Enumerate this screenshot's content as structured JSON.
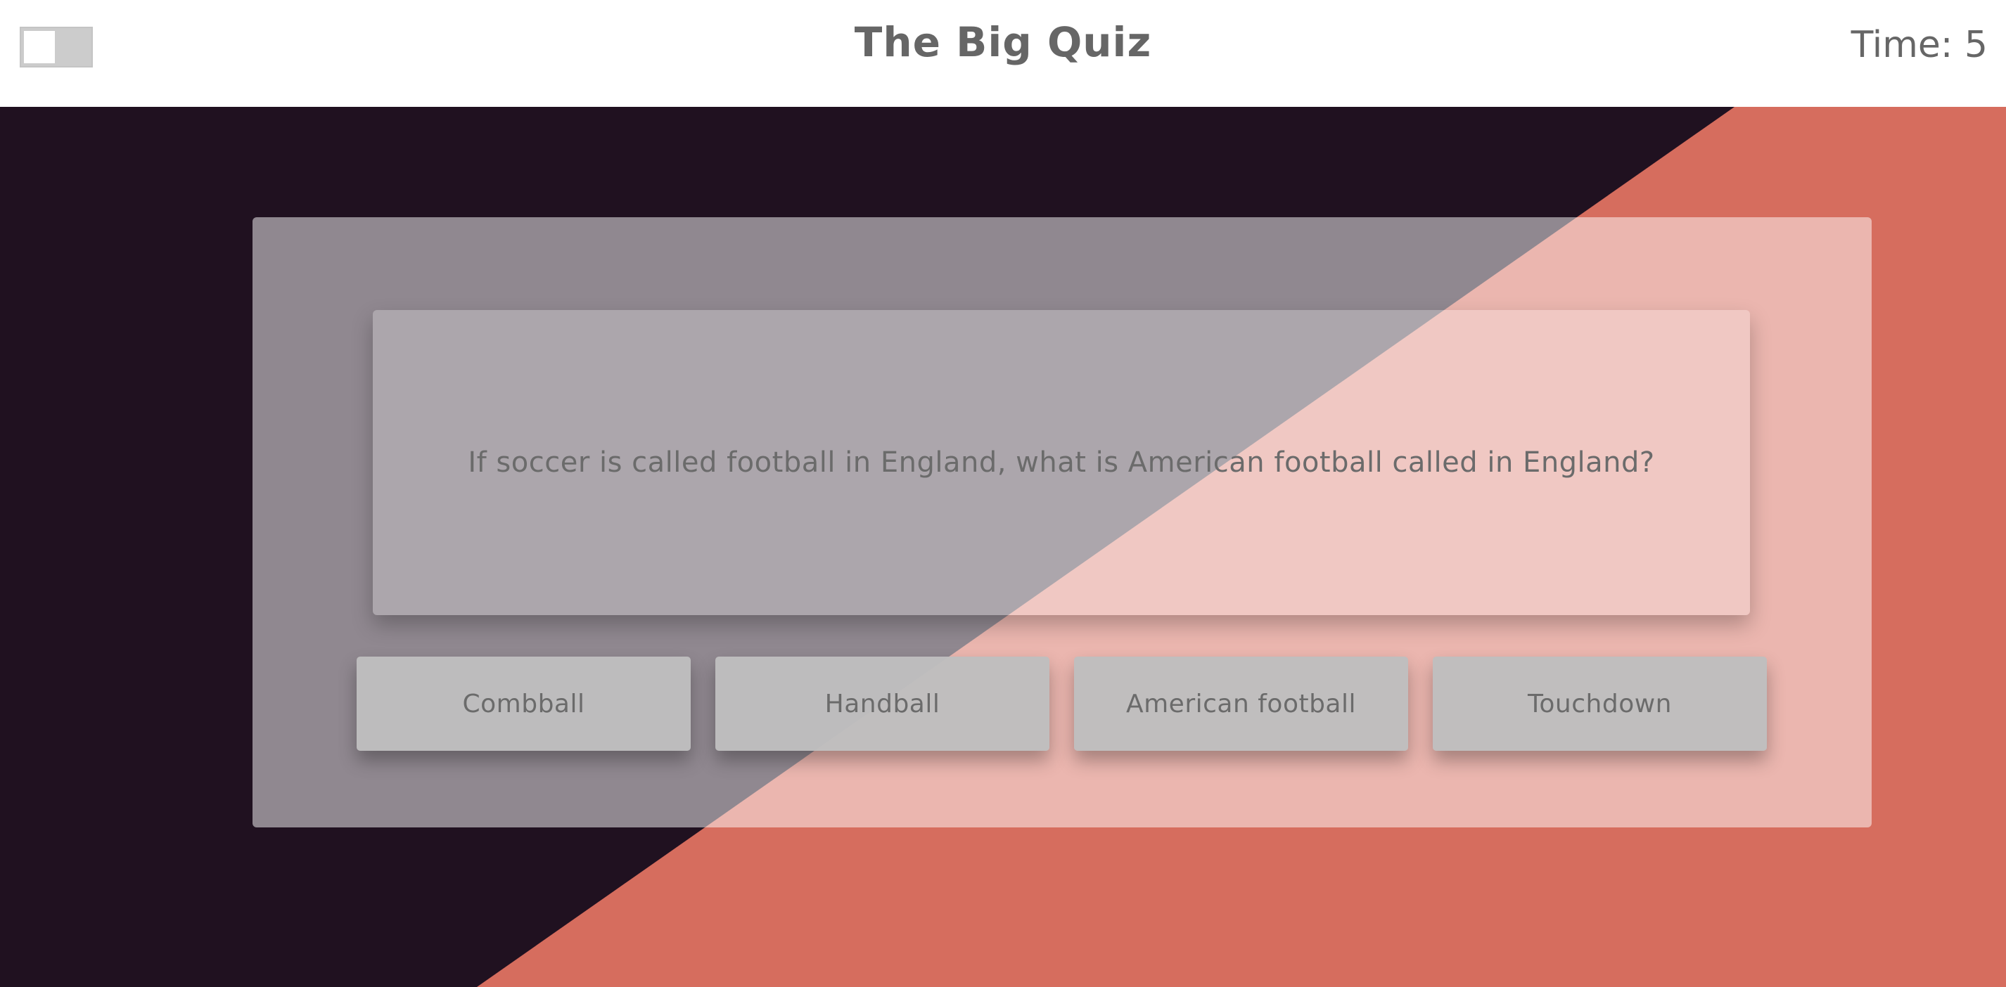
{
  "header": {
    "title": "The Big Quiz",
    "timer": "Time: 5"
  },
  "theme": {
    "dark_bg": "#201120",
    "accent_bg": "#d66d5e",
    "header_bg": "#ffffff",
    "text_color": "#666666"
  },
  "toggle": {
    "icon": "toggle-switch-off"
  },
  "quiz": {
    "question": "If soccer is called football in England, what is American football called in England?",
    "answers": [
      {
        "label": "Combball"
      },
      {
        "label": "Handball"
      },
      {
        "label": "American football"
      },
      {
        "label": "Touchdown"
      }
    ]
  }
}
